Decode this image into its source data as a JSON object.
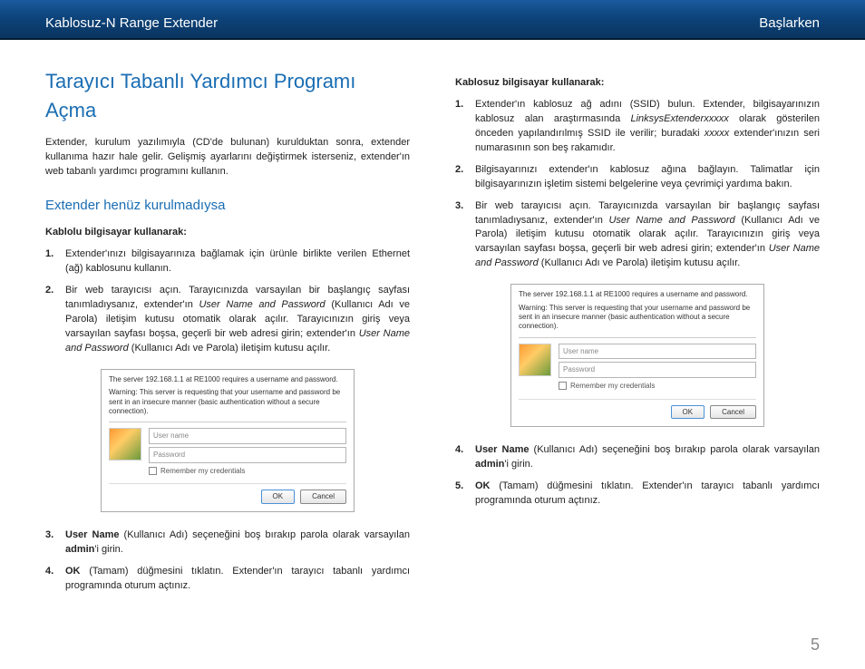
{
  "header": {
    "left": "Kablosuz-N Range Extender",
    "right": "Başlarken"
  },
  "left_col": {
    "h1": "Tarayıcı Tabanlı Yardımcı Programı Açma",
    "intro": "Extender, kurulum yazılımıyla (CD'de bulunan) kurulduktan sonra, extender kullanıma hazır hale gelir. Gelişmiş ayarlarını değiştirmek isterseniz, extender'ın web tabanlı yardımcı programını kullanın.",
    "h2": "Extender henüz kurulmadıysa",
    "h3": "Kablolu bilgisayar kullanarak:",
    "item1": "Extender'ınızı bilgisayarınıza bağlamak için ürünle birlikte verilen Ethernet (ağ) kablosunu kullanın.",
    "item2_a": "Bir web tarayıcısı açın. Tarayıcınızda varsayılan bir başlangıç sayfası tanımladıysanız, extender'ın ",
    "item2_b": "User Name and Password",
    "item2_c": " (Kullanıcı Adı ve Parola) iletişim kutusu otomatik olarak açılır. Tarayıcınızın giriş veya varsayılan sayfası boşsa, geçerli bir web adresi girin; extender'ın ",
    "item2_d": "User Name and Password",
    "item2_e": " (Kullanıcı Adı ve Parola) iletişim kutusu açılır.",
    "item3_a": "User Name ",
    "item3_b": "(Kullanıcı Adı) seçeneğini boş bırakıp parola olarak varsayılan ",
    "item3_c": "admin",
    "item3_d": "'i girin.",
    "item4_a": "OK",
    "item4_b": " (Tamam) düğmesini tıklatın. Extender'ın tarayıcı tabanlı yardımcı programında oturum açtınız."
  },
  "right_col": {
    "h3": "Kablosuz bilgisayar kullanarak:",
    "item1_a": "Extender'ın kablosuz ağ adını (SSID) bulun. Extender, bilgisayarınızın kablosuz alan araştırmasında ",
    "item1_b": "LinksysExtenderxxxxx",
    "item1_c": " olarak gösterilen önceden yapılandırılmış SSID ile verilir; buradaki ",
    "item1_d": "xxxxx",
    "item1_e": " extender'ınızın seri numarasının son beş rakamıdır.",
    "item2": "Bilgisayarınızı extender'ın kablosuz ağına bağlayın. Talimatlar için bilgisayarınızın işletim sistemi belgelerine veya çevrimiçi yardıma bakın.",
    "item3_a": "Bir web tarayıcısı açın. Tarayıcınızda varsayılan bir başlangıç sayfası tanımladıysanız, extender'ın ",
    "item3_b": "User Name and Password",
    "item3_c": " (Kullanıcı Adı ve Parola) iletişim kutusu otomatik olarak açılır. Tarayıcınızın giriş veya varsayılan sayfası boşsa, geçerli bir web adresi girin; extender'ın ",
    "item3_d": "User Name and Password",
    "item3_e": " (Kullanıcı Adı ve Parola) iletişim kutusu açılır.",
    "item4_a": "User Name ",
    "item4_b": "(Kullanıcı Adı) seçeneğini boş bırakıp parola olarak varsayılan ",
    "item4_c": "admin",
    "item4_d": "'i girin.",
    "item5_a": "OK",
    "item5_b": " (Tamam) düğmesini tıklatın. Extender'ın tarayıcı tabanlı yardımcı programında oturum açtınız."
  },
  "dialog": {
    "line1": "The server 192.168.1.1 at RE1000 requires a username and password.",
    "line2": "Warning: This server is requesting that your username and password be sent in an insecure manner (basic authentication without a secure connection).",
    "user": "User name",
    "pass": "Password",
    "remember": "Remember my credentials",
    "ok": "OK",
    "cancel": "Cancel"
  },
  "page_num": "5"
}
